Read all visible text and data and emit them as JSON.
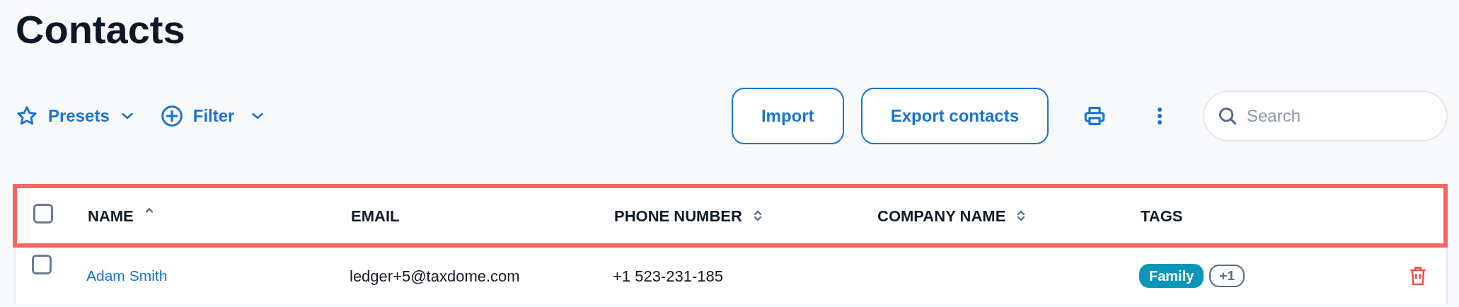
{
  "page": {
    "title": "Contacts"
  },
  "toolbar": {
    "presets": "Presets",
    "filter": "Filter",
    "buttons": [
      "Import",
      "Export contacts"
    ],
    "search": {
      "placeholder": "Search"
    }
  },
  "table": {
    "select_all": {
      "checked": false
    },
    "columns": [
      {
        "label": "NAME",
        "sortable": true,
        "sorted": true
      },
      {
        "label": "EMAIL",
        "sortable": false
      },
      {
        "label": "PHONE NUMBER",
        "sortable": true,
        "sorted": false
      },
      {
        "label": "COMPANY NAME",
        "sortable": true,
        "sorted": false
      },
      {
        "label": "TAGS",
        "sortable": false
      }
    ],
    "rows": [
      {
        "checked": false,
        "name": "Adam Smith",
        "email": "ledger+5@taxdome.com",
        "phone": "+1 523-231-185",
        "tags": [
          {
            "label": "Family",
            "color": "#0a96b8"
          }
        ],
        "more_tags": "+1"
      }
    ]
  }
}
